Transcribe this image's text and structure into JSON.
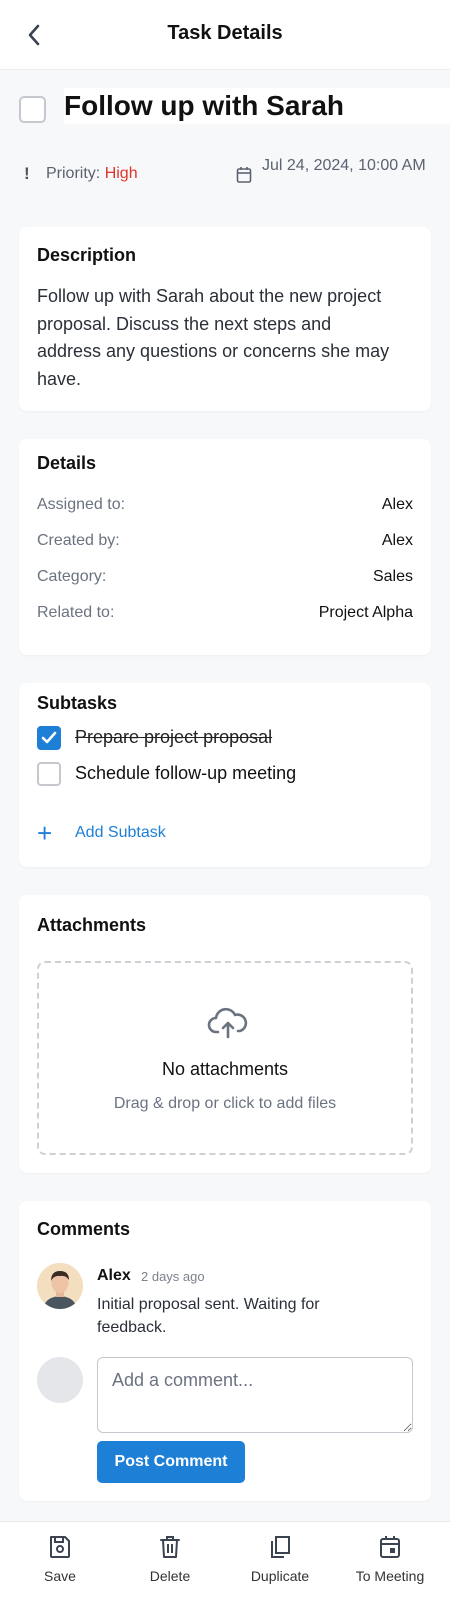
{
  "header": {
    "title": "Task Details",
    "back_icon": "chevron-left-icon"
  },
  "task": {
    "title": "Follow up with Sarah",
    "completed": false,
    "priority_label": "Priority:",
    "priority_value": "High",
    "priority_color": "#e0352b",
    "due": "Jul 24, 2024, 10:00 AM"
  },
  "description": {
    "heading": "Description",
    "text": "Follow up with Sarah about the new project proposal. Discuss the next steps and address any questions or concerns she may have."
  },
  "details": {
    "heading": "Details",
    "rows": [
      {
        "label": "Assigned to:",
        "value": "Alex"
      },
      {
        "label": "Created by:",
        "value": "Alex"
      },
      {
        "label": "Category:",
        "value": "Sales"
      },
      {
        "label": "Related to:",
        "value": "Project Alpha"
      }
    ]
  },
  "subtasks": {
    "heading": "Subtasks",
    "items": [
      {
        "label": "Prepare project proposal",
        "done": true
      },
      {
        "label": "Schedule follow-up meeting",
        "done": false
      }
    ],
    "add_label": "Add Subtask"
  },
  "attachments": {
    "heading": "Attachments",
    "empty_title": "No attachments",
    "empty_hint": "Drag & drop or click to add files"
  },
  "comments": {
    "heading": "Comments",
    "items": [
      {
        "author": "Alex",
        "time": "2 days ago",
        "text": "Initial proposal sent. Waiting for feedback."
      }
    ],
    "input_placeholder": "Add a comment...",
    "post_label": "Post Comment"
  },
  "bottom_bar": [
    {
      "label": "Save",
      "icon": "save-icon"
    },
    {
      "label": "Delete",
      "icon": "trash-icon"
    },
    {
      "label": "Duplicate",
      "icon": "duplicate-icon"
    },
    {
      "label": "To Meeting",
      "icon": "calendar-icon"
    }
  ],
  "colors": {
    "accent": "#1e7fd6",
    "priority_high": "#e0352b"
  }
}
